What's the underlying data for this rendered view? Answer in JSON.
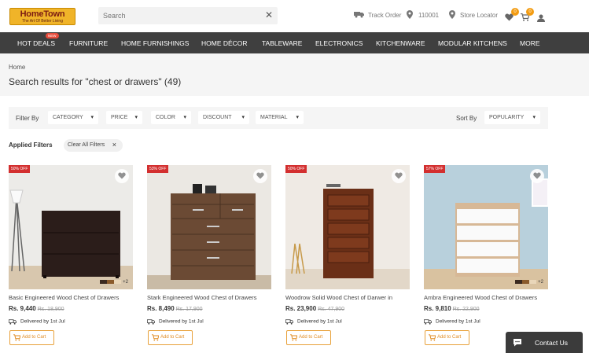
{
  "header": {
    "logo_title": "HomeTown",
    "logo_tagline": "The Art Of Better Living",
    "search_placeholder": "Search",
    "track_order": "Track Order",
    "pincode": "110001",
    "store_locator": "Store Locator",
    "wishlist_count": "0",
    "cart_count": "0"
  },
  "nav": {
    "new_badge": "NEW",
    "items": [
      "HOT DEALS",
      "FURNITURE",
      "HOME FURNISHINGS",
      "HOME DÉCOR",
      "TABLEWARE",
      "ELECTRONICS",
      "KITCHENWARE",
      "MODULAR KITCHENS",
      "MORE"
    ]
  },
  "page": {
    "breadcrumb": "Home",
    "results_title": "Search results for \"chest or drawers\" (49)"
  },
  "filters": {
    "label": "Filter By",
    "items": [
      "CATEGORY",
      "PRICE",
      "COLOR",
      "DISCOUNT",
      "MATERIAL"
    ],
    "sort_label": "Sort By",
    "sort_value": "POPULARITY",
    "applied_label": "Applied Filters",
    "clear_all": "Clear All Filters"
  },
  "products": [
    {
      "discount": "50% OFF",
      "name": "Basic Engineered Wood Chest of Drawers",
      "price": "Rs. 9,440",
      "mrp": "Rs. 18,900",
      "delivery": "Delivered by 1st Jul",
      "cart": "Add to Cart",
      "more_colors": "+2"
    },
    {
      "discount": "53% OFF",
      "name": "Stark Engineered Wood Chest of Drawers",
      "price": "Rs. 8,490",
      "mrp": "Rs. 17,900",
      "delivery": "Delivered by 1st Jul",
      "cart": "Add to Cart",
      "more_colors": ""
    },
    {
      "discount": "50% OFF",
      "name": "Woodrow Solid Wood Chest of Darwer in",
      "price": "Rs. 23,900",
      "mrp": "Rs. 47,900",
      "delivery": "Delivered by 1st Jul",
      "cart": "Add to Cart",
      "more_colors": ""
    },
    {
      "discount": "57% OFF",
      "name": "Ambra Engineered Wood Chest of Drawers",
      "price": "Rs. 9,810",
      "mrp": "Rs. 22,900",
      "delivery": "Delivered by 1st Jul",
      "cart": "Add to Cart",
      "more_colors": "+2"
    }
  ],
  "chat": {
    "label": "Contact Us"
  },
  "colors": {
    "accent": "#e8a13a",
    "nav_bg": "#3f3f3f",
    "discount_bg": "#d32f2f"
  }
}
